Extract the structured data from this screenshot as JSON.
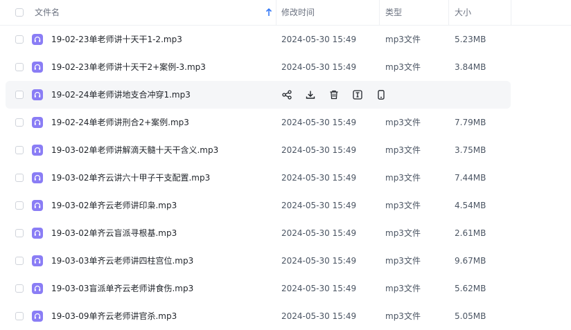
{
  "header": {
    "name": "文件名",
    "modified": "修改时间",
    "type": "类型",
    "size": "大小"
  },
  "icons": {
    "file": "audio-file-icon",
    "sort": "sort-ascending-icon",
    "actions": [
      "share-icon",
      "download-icon",
      "delete-icon",
      "rename-icon",
      "open-on-phone-icon"
    ]
  },
  "colors": {
    "file_icon": "#8a7df5",
    "hover_row": "#f5f6f8",
    "sort_arrow": "#3478f6"
  },
  "rows": [
    {
      "name": "19-02-23单老师讲十天干1-2.mp3",
      "modified": "2024-05-30 15:49",
      "type": "mp3文件",
      "size": "5.23MB",
      "hovered": false
    },
    {
      "name": "19-02-23单老师讲十天干2+案例-3.mp3",
      "modified": "2024-05-30 15:49",
      "type": "mp3文件",
      "size": "3.84MB",
      "hovered": false
    },
    {
      "name": "19-02-24单老师讲地支合冲穿1.mp3",
      "modified": "",
      "type": "",
      "size": "",
      "hovered": true
    },
    {
      "name": "19-02-24单老师讲刑合2+案例.mp3",
      "modified": "2024-05-30 15:49",
      "type": "mp3文件",
      "size": "7.79MB",
      "hovered": false
    },
    {
      "name": "19-03-02单老师讲解滴天髓十天干含义.mp3",
      "modified": "2024-05-30 15:49",
      "type": "mp3文件",
      "size": "3.75MB",
      "hovered": false
    },
    {
      "name": "19-03-02单齐云讲六十甲子干支配置.mp3",
      "modified": "2024-05-30 15:49",
      "type": "mp3文件",
      "size": "7.44MB",
      "hovered": false
    },
    {
      "name": "19-03-02单齐云老师讲印枭.mp3",
      "modified": "2024-05-30 15:49",
      "type": "mp3文件",
      "size": "4.54MB",
      "hovered": false
    },
    {
      "name": "19-03-02单齐云盲派寻根基.mp3",
      "modified": "2024-05-30 15:49",
      "type": "mp3文件",
      "size": "2.61MB",
      "hovered": false
    },
    {
      "name": "19-03-03单齐云老师讲四柱宫位.mp3",
      "modified": "2024-05-30 15:49",
      "type": "mp3文件",
      "size": "9.67MB",
      "hovered": false
    },
    {
      "name": "19-03-03盲派单齐云老师讲食伤.mp3",
      "modified": "2024-05-30 15:49",
      "type": "mp3文件",
      "size": "5.62MB",
      "hovered": false
    },
    {
      "name": "19-03-09单齐云老师讲官杀.mp3",
      "modified": "2024-05-30 15:49",
      "type": "mp3文件",
      "size": "5.05MB",
      "hovered": false
    }
  ]
}
